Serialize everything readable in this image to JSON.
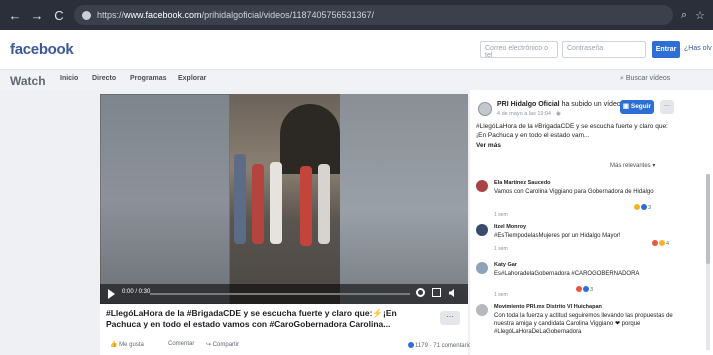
{
  "browser": {
    "url_prefix": "https://",
    "url_host": "www.facebook.com",
    "url_path": "/prihidalgoficial/videos/1187405756531367/"
  },
  "header": {
    "logo": "facebook",
    "email_placeholder": "Correo electrónico o tel",
    "password_placeholder": "Contraseña",
    "login_label": "Entrar",
    "forgot_label": "¿Has olv"
  },
  "nav": {
    "title": "Watch",
    "tabs": [
      "Inicio",
      "Directo",
      "Programas",
      "Explorar"
    ],
    "search_label": "Buscar vídeos"
  },
  "video": {
    "time": "0:00 / 0:30",
    "progress": 0.0,
    "title": "#LlegóLaHora de la #BrigadaCDE y se escucha fuerte y claro que:⚡¡En Pachuca y en todo el estado vamos con #CaroGobernadora Carolina...",
    "more_label": "···",
    "actions": {
      "like": "Me gusta",
      "comment": "Comentar",
      "share": "Compartir"
    },
    "stats": "1179 · 71 comentarios"
  },
  "sidebar": {
    "page_name": "PRI Hidalgo Oficial",
    "page_action": "ha subido un vídeo.",
    "post_date": "4 de mayo a las 19:04 · ",
    "follow_label": "Seguir",
    "page_more": "···",
    "post_text": "#LlegóLaHora de la #BrigadaCDE y se escucha fuerte y claro que: ¡En Pachuca y en todo el estado vam...",
    "see_more": "Ver más",
    "sort_label": "Más relevantes ▾",
    "comments": [
      {
        "author": "Ela Martínez Saucedo",
        "text": "Vamos con Carolina Viggiano para Gobernadora de Hidalgo",
        "time": "1 sem",
        "reactions": "3",
        "avatar_color": "#a44"
      },
      {
        "author": "Itzel Monroy",
        "text": "#EsTiempodelasMujeres por un Hidalgo Mayor!",
        "time": "1 sem",
        "reactions": "4",
        "avatar_color": "#3b4a6b"
      },
      {
        "author": "Katy Gar",
        "text": "Es#LahoradelaGobernadora #CAROGOBERNADORA",
        "time": "1 sem",
        "reactions": "3",
        "avatar_color": "#8fa3b8"
      },
      {
        "author": "Movimiento PRI.mx Distrito VI Huichapan",
        "text": "Con toda la fuerza y actitud seguiremos llevando las propuestas de nuestra amiga y candidata Carolina Viggiano ❤ porque #LlegóLaHoraDeLaGobernadora",
        "time": "",
        "reactions": "",
        "avatar_color": "#b7b9bd"
      }
    ]
  }
}
